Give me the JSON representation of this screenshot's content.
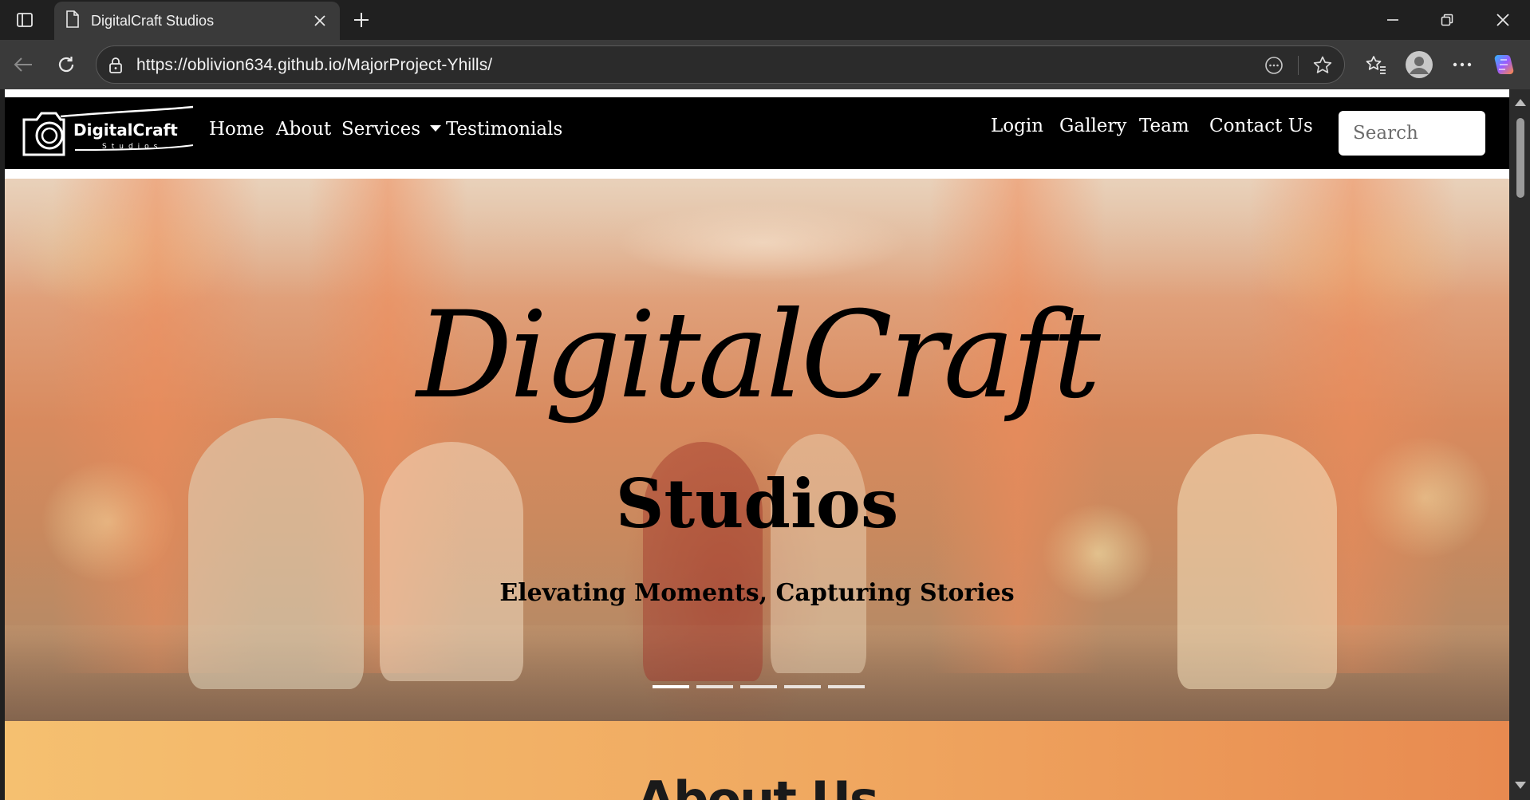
{
  "browser": {
    "tab_title": "DigitalCraft Studios",
    "url": "https://oblivion634.github.io/MajorProject-Yhills/"
  },
  "site": {
    "logo": {
      "brand": "DigitalCraft",
      "tagline": "Studios"
    },
    "nav_left": [
      "Home",
      "About",
      "Services",
      "Testimonials"
    ],
    "nav_right": [
      "Login",
      "Gallery",
      "Team",
      "Contact Us"
    ],
    "search_placeholder": "Search"
  },
  "hero": {
    "title": "DigitalCraft",
    "subtitle": "Studios",
    "tagline": "Elevating Moments, Capturing Stories",
    "slide_count": 5,
    "active_slide": 1
  },
  "about": {
    "title": "About Us"
  },
  "colors": {
    "nav_bg": "#000000",
    "about_gradient_start": "#f5c070",
    "about_gradient_end": "#e88a50"
  }
}
